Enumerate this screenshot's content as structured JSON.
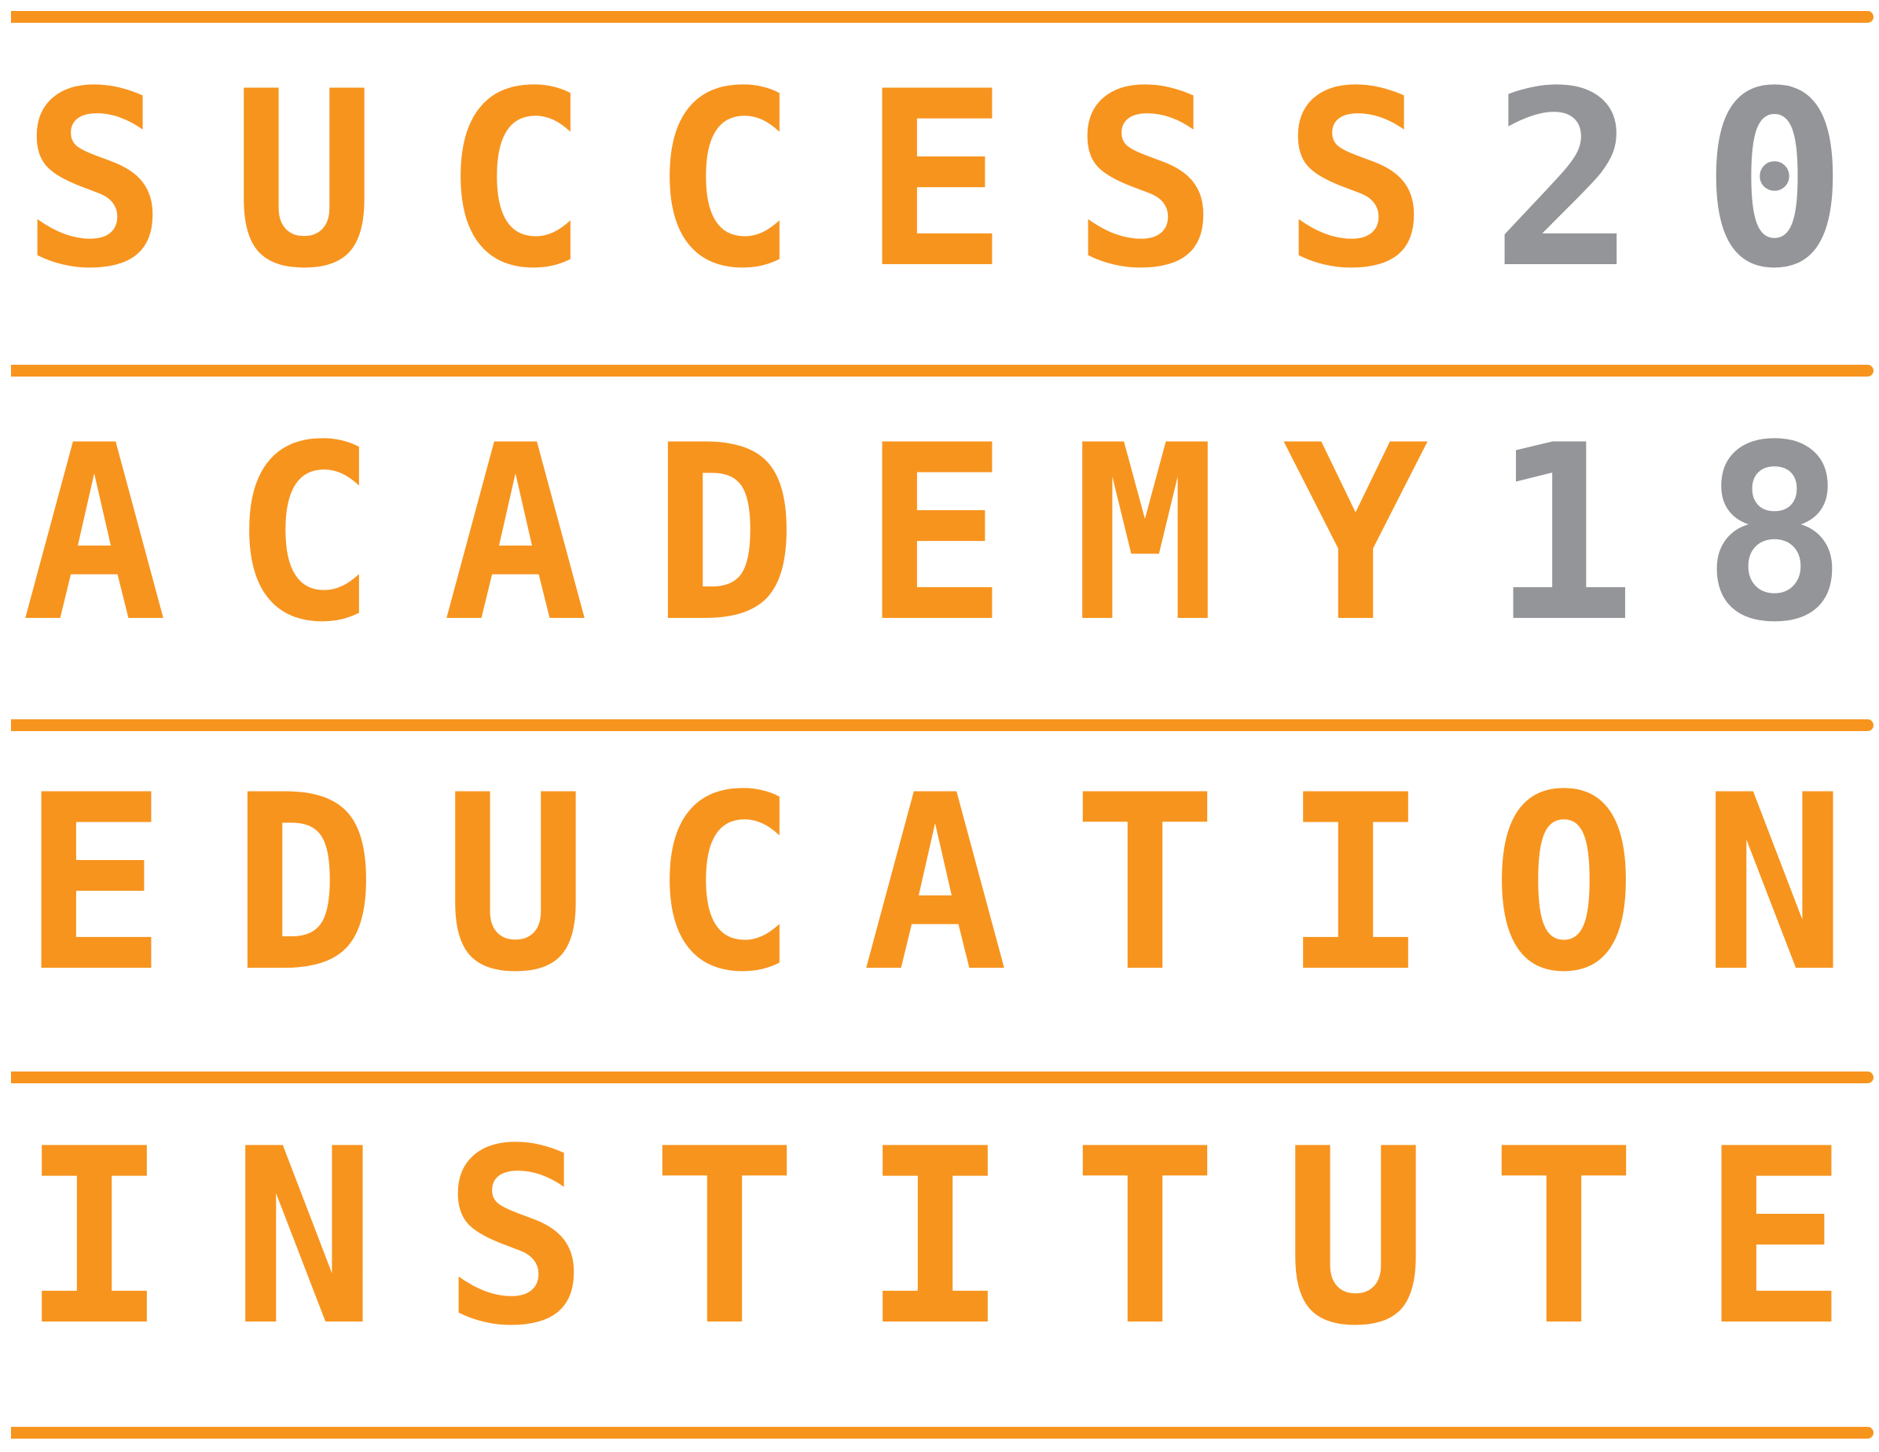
{
  "colors": {
    "orange": "#F7941E",
    "gray": "#939598"
  },
  "lines": [
    {
      "words": [
        "SUCCESS"
      ],
      "number": "20"
    },
    {
      "words": [
        "ACADEMY"
      ],
      "number": "18"
    },
    {
      "words": [
        "EDUCATION"
      ],
      "number": ""
    },
    {
      "words": [
        "INSTITUTE"
      ],
      "number": ""
    }
  ]
}
